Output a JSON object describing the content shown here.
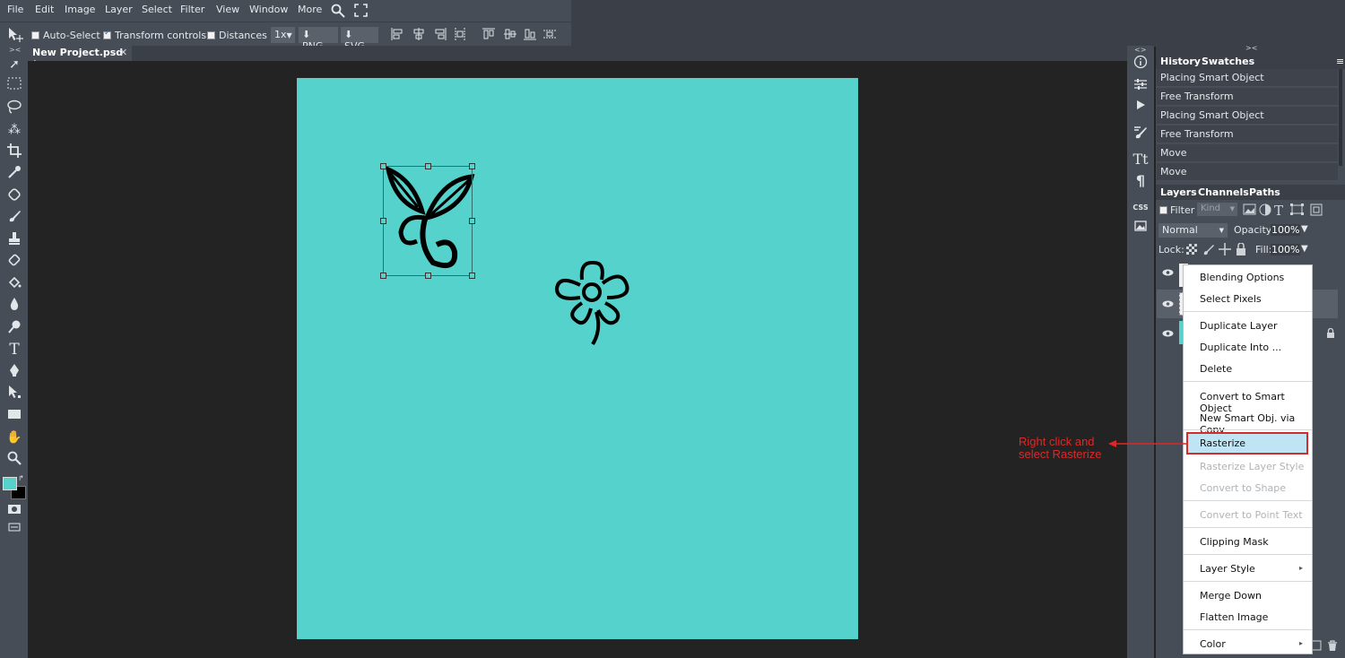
{
  "menu": [
    "File",
    "Edit",
    "Image",
    "Layer",
    "Select",
    "Filter",
    "View",
    "Window",
    "More"
  ],
  "options_bar": {
    "auto_select": "Auto-Select",
    "transform_controls": "Transform controls",
    "distances": "Distances",
    "zoom": "1x",
    "png": "PNG",
    "svg": "SVG"
  },
  "document": {
    "tab_title": "New Project.psd *",
    "close": "✕",
    "canvas_color": "#55d2cc"
  },
  "right_icons": [
    "info-icon",
    "adjustments-icon",
    "play-icon",
    "brush-settings-icon",
    "character-icon",
    "paragraph-icon",
    "css-icon",
    "image-icon"
  ],
  "right_icon_labels": {
    "css": "CSS",
    "character": "Tt",
    "paragraph": "¶"
  },
  "history_panel": {
    "tabs": [
      "History",
      "Swatches"
    ],
    "items": [
      "Placing Smart Object",
      "Free Transform",
      "Placing Smart Object",
      "Free Transform",
      "Move",
      "Move"
    ]
  },
  "layers_panel": {
    "tabs": [
      "Layers",
      "Channels",
      "Paths"
    ],
    "filter_label": "Filter",
    "kind_placeholder": "Kind",
    "blend_mode": "Normal",
    "opacity_label": "Opacity:",
    "opacity_value": "100%",
    "lock_label": "Lock:",
    "fill_label": "Fill:",
    "fill_value": "100%"
  },
  "context_menu": {
    "items": [
      {
        "label": "Blending Options",
        "disabled": false
      },
      {
        "label": "Select Pixels",
        "disabled": false
      },
      {
        "label": "Duplicate Layer",
        "disabled": false
      },
      {
        "label": "Duplicate Into ...",
        "disabled": false
      },
      {
        "label": "Delete",
        "disabled": false
      },
      {
        "label": "Convert to Smart Object",
        "disabled": false
      },
      {
        "label": "New Smart Obj. via Copy",
        "disabled": false
      },
      {
        "label": "Rasterize",
        "disabled": false
      },
      {
        "label": "Rasterize Layer Style",
        "disabled": true
      },
      {
        "label": "Convert to Shape",
        "disabled": true
      },
      {
        "label": "Convert to Point Text",
        "disabled": true
      },
      {
        "label": "Clipping Mask",
        "disabled": false
      },
      {
        "label": "Layer Style",
        "disabled": false
      },
      {
        "label": "Merge Down",
        "disabled": false
      },
      {
        "label": "Flatten Image",
        "disabled": false
      },
      {
        "label": "Color",
        "disabled": false
      }
    ],
    "submenu_arrow": "▸"
  },
  "annotation": {
    "line1": "Right click and",
    "line2": "select Rasterize",
    "color": "#e02727"
  },
  "colors": {
    "foreground": "#55d2cc",
    "background": "#000000"
  }
}
